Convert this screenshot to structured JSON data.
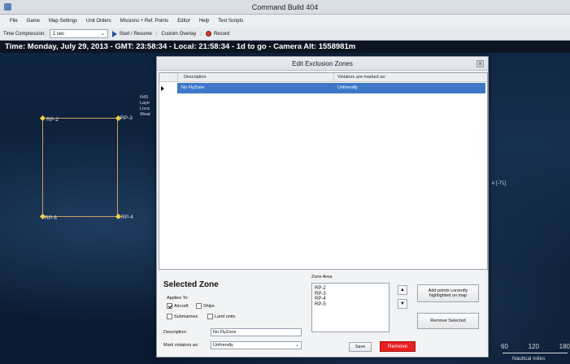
{
  "window": {
    "title": "Command Build 404"
  },
  "menu": [
    "File",
    "Game",
    "Map Settings",
    "Unit Orders",
    "Missions + Ref. Points",
    "Editor",
    "Help",
    "Test Scripts"
  ],
  "toolbar": {
    "time_compression_label": "Time Compression:",
    "time_compression_value": "1 sec",
    "start_resume": "Start / Resume",
    "custom_overlay": "Custom Overlay",
    "record": "Record"
  },
  "status_line": "Time: Monday, July 29, 2013 - GMT: 23:58:34 - Local: 21:58:34 - 1d to go -  Camera Alt: 1558981m",
  "map": {
    "points": [
      "RP-2",
      "RP-3",
      "RP-4",
      "RP-5"
    ],
    "info_lines": [
      "N43",
      "Laye",
      "Loca",
      "Weat"
    ],
    "side_label": "e [-71]",
    "scale_numbers": [
      "60",
      "120",
      "180"
    ],
    "scale_label": "Nautical miles"
  },
  "dialog": {
    "title": "Edit Exclusion Zones",
    "close": "x",
    "columns": [
      "Description",
      "Violators are marked as:"
    ],
    "rows": [
      {
        "description": "No FlyZone",
        "marked_as": "Unfriendly"
      }
    ],
    "selected_zone_title": "Selected Zone",
    "applies_to_label": "Applies To:",
    "checkboxes": {
      "aircraft": {
        "label": "Aircraft",
        "checked": true
      },
      "ships": {
        "label": "Ships",
        "checked": false
      },
      "submarines": {
        "label": "Submarines",
        "checked": false
      },
      "land_units": {
        "label": "Land units",
        "checked": false
      }
    },
    "description_label": "Description:",
    "description_value": "No FlyZone",
    "mark_violators_label": "Mark violators as:",
    "mark_violators_value": "Unfriendly",
    "zone_area_label": "Zone Area",
    "zone_area_points": [
      "RP-2",
      "RP-3",
      "RP-4",
      "RP-5"
    ],
    "move_up": "▲",
    "move_down": "▼",
    "add_points_button": "Add points currently highlighted on map",
    "remove_selected_button": "Remove Selected",
    "save_button": "Save",
    "remove_button": "Remove"
  }
}
